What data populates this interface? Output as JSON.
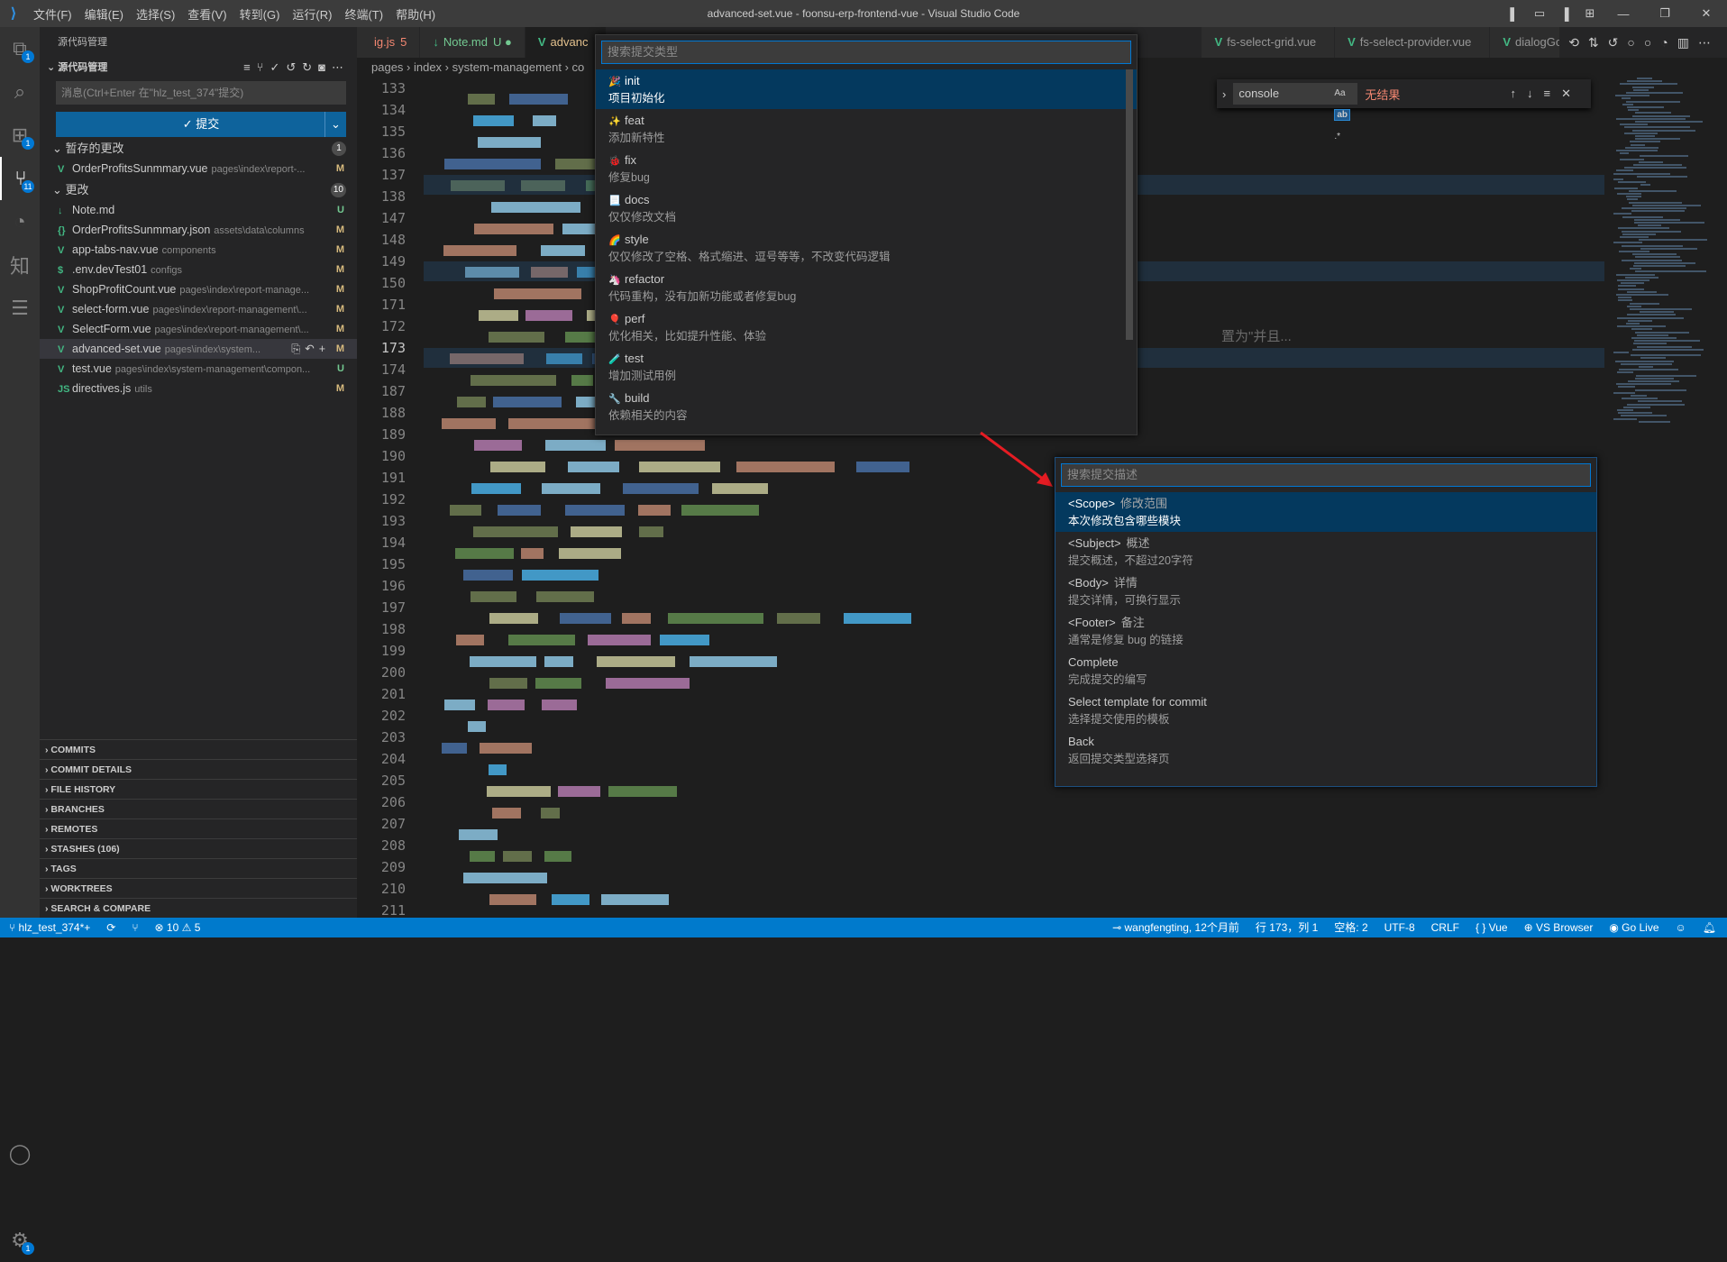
{
  "titlebar": {
    "title": "advanced-set.vue - foonsu-erp-frontend-vue - Visual Studio Code",
    "menu": [
      "文件(F)",
      "编辑(E)",
      "选择(S)",
      "查看(V)",
      "转到(G)",
      "运行(R)",
      "终端(T)",
      "帮助(H)"
    ]
  },
  "activity": {
    "explorer_badge": "1",
    "extensions_badge": "1",
    "scm_badge": "11",
    "settings_badge": "1",
    "knowledge_label": "知"
  },
  "sidebar": {
    "title": "源代码管理",
    "section": "源代码管理",
    "message_placeholder": "消息(Ctrl+Enter 在\"hlz_test_374\"提交)",
    "commit_label": "✓ 提交",
    "staged": {
      "label": "暂存的更改",
      "count": "1",
      "files": [
        {
          "icon": "V",
          "name": "OrderProfitsSunmmary.vue",
          "path": "pages\\index\\report-...",
          "status": "M"
        }
      ]
    },
    "changes": {
      "label": "更改",
      "count": "10",
      "files": [
        {
          "icon": "↓",
          "name": "Note.md",
          "path": "",
          "status": "U"
        },
        {
          "icon": "{}",
          "name": "OrderProfitsSunmmary.json",
          "path": "assets\\data\\columns",
          "status": "M"
        },
        {
          "icon": "V",
          "name": "app-tabs-nav.vue",
          "path": "components",
          "status": "M"
        },
        {
          "icon": "$",
          "name": ".env.devTest01",
          "path": "configs",
          "status": "M"
        },
        {
          "icon": "V",
          "name": "ShopProfitCount.vue",
          "path": "pages\\index\\report-manage...",
          "status": "M"
        },
        {
          "icon": "V",
          "name": "select-form.vue",
          "path": "pages\\index\\report-management\\...",
          "status": "M"
        },
        {
          "icon": "V",
          "name": "SelectForm.vue",
          "path": "pages\\index\\report-management\\...",
          "status": "M"
        },
        {
          "icon": "V",
          "name": "advanced-set.vue",
          "path": "pages\\index\\system...",
          "status": "M"
        },
        {
          "icon": "V",
          "name": "test.vue",
          "path": "pages\\index\\system-management\\compon...",
          "status": "U"
        },
        {
          "icon": "JS",
          "name": "directives.js",
          "path": "utils",
          "status": "M"
        }
      ]
    },
    "panels": [
      "COMMITS",
      "COMMIT DETAILS",
      "FILE HISTORY",
      "BRANCHES",
      "REMOTES",
      "STASHES (106)",
      "TAGS",
      "WORKTREES",
      "SEARCH & COMPARE"
    ]
  },
  "tabs": [
    {
      "label": "ig.js",
      "suffix": "5",
      "color": "#f48771"
    },
    {
      "label": "Note.md",
      "suffix": "U ●",
      "color": "#73c991"
    },
    {
      "label": "advanc",
      "suffix": "",
      "color": "#e2c08d"
    },
    {
      "label": "fs-select-grid.vue",
      "suffix": "",
      "color": "#969696"
    },
    {
      "label": "fs-select-provider.vue",
      "suffix": "",
      "color": "#969696"
    },
    {
      "label": "dialogGoc",
      "suffix": "",
      "color": "#969696"
    }
  ],
  "breadcrumbs": "pages › index › system-management › co",
  "editor": {
    "line_numbers": [
      "133",
      "134",
      "135",
      "136",
      "137",
      "138",
      "147",
      "148",
      "149",
      "150",
      "171",
      "172",
      "173",
      "174",
      "187",
      "188",
      "189",
      "190",
      "191",
      "192",
      "193",
      "194",
      "195",
      "196",
      "197",
      "198",
      "199",
      "200",
      "201",
      "202",
      "203",
      "204",
      "205",
      "206",
      "207",
      "208",
      "209",
      "210",
      "211"
    ],
    "current_line": "173",
    "ghost_text": "置为\"并且..."
  },
  "find": {
    "value": "console",
    "case": "Aa",
    "word": "ab",
    "regex": ".*",
    "result": "无结果"
  },
  "quickpick_type": {
    "placeholder": "搜索提交类型",
    "items": [
      {
        "emoji": "🎉",
        "label": "init",
        "detail": "项目初始化"
      },
      {
        "emoji": "✨",
        "label": "feat",
        "detail": "添加新特性"
      },
      {
        "emoji": "🐞",
        "label": "fix",
        "detail": "修复bug"
      },
      {
        "emoji": "📃",
        "label": "docs",
        "detail": "仅仅修改文档"
      },
      {
        "emoji": "🌈",
        "label": "style",
        "detail": "仅仅修改了空格、格式缩进、逗号等等，不改变代码逻辑"
      },
      {
        "emoji": "🦄",
        "label": "refactor",
        "detail": "代码重构，没有加新功能或者修复bug"
      },
      {
        "emoji": "🎈",
        "label": "perf",
        "detail": "优化相关，比如提升性能、体验"
      },
      {
        "emoji": "🧪",
        "label": "test",
        "detail": "增加测试用例"
      },
      {
        "emoji": "🔧",
        "label": "build",
        "detail": "依赖相关的内容"
      }
    ]
  },
  "quickpick_desc": {
    "placeholder": "搜索提交描述",
    "items": [
      {
        "label": "<Scope>",
        "desc": "修改范围",
        "detail": "本次修改包含哪些模块"
      },
      {
        "label": "<Subject>",
        "desc": "概述",
        "detail": "提交概述，不超过20字符"
      },
      {
        "label": "<Body>",
        "desc": "详情",
        "detail": "提交详情，可换行显示"
      },
      {
        "label": "<Footer>",
        "desc": "备注",
        "detail": "通常是修复 bug 的链接"
      },
      {
        "label": "Complete",
        "desc": "",
        "detail": "完成提交的编写"
      },
      {
        "label": "Select template for commit",
        "desc": "",
        "detail": "选择提交使用的模板"
      },
      {
        "label": "Back",
        "desc": "",
        "detail": "返回提交类型选择页"
      }
    ]
  },
  "statusbar": {
    "branch": "hlz_test_374*+",
    "problems": "⊗ 10 ⚠ 5",
    "blame": "wangfengting, 12个月前",
    "position": "行 173，列 1",
    "spaces": "空格: 2",
    "encoding": "UTF-8",
    "eol": "CRLF",
    "language": "{ } Vue",
    "browser": "VS Browser",
    "golive": "Go Live"
  },
  "colors": {
    "accent": "#007acc",
    "selection": "#04395e",
    "arrow": "#e51c23"
  }
}
